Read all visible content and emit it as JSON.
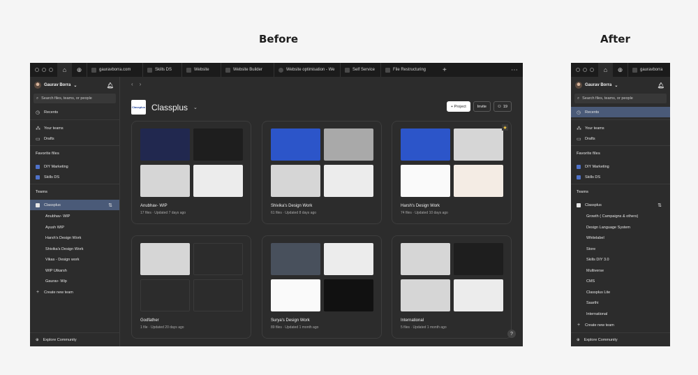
{
  "labels": {
    "before": "Before",
    "after": "After"
  },
  "before": {
    "tabs": [
      {
        "label": "gauravborra.com"
      },
      {
        "label": "Skills DS"
      },
      {
        "label": "Website"
      },
      {
        "label": "Website Builder"
      },
      {
        "label": "Website optimisation - We"
      },
      {
        "label": "Self Service"
      },
      {
        "label": "File Restructuring"
      }
    ],
    "user_name": "Gaurav Borra",
    "search_placeholder": "Search files, teams, or people",
    "nav": {
      "recents": "Recents",
      "your_teams": "Your teams",
      "drafts": "Drafts"
    },
    "favorite_files_label": "Favorite files",
    "favorites": [
      {
        "label": "DIY Marketing"
      },
      {
        "label": "Skills DS"
      }
    ],
    "teams_label": "Teams",
    "team": "Classplus",
    "projects": [
      "Anubhav- WIP",
      "Ayush WIP",
      "Harsh's Design Work",
      "Shivika's Design Work",
      "Vikas - Design work",
      "WIP Utkarsh",
      "Gaurav- Wip"
    ],
    "create_team": "Create new team",
    "explore": "Explore Community",
    "header": {
      "title": "Classplus",
      "logo_text": "Classplus",
      "project_button": "+ Project",
      "invite_button": "Invite",
      "members_count": "19"
    },
    "cards": [
      {
        "name": "Anubhav- WIP",
        "meta": "17 files · Updated 7 days ago"
      },
      {
        "name": "Shivika's Design Work",
        "meta": "61 files · Updated 8 days ago"
      },
      {
        "name": "Harsh's Design Work",
        "meta": "74 files · Updated 10 days ago"
      },
      {
        "name": "Godfather",
        "meta": "1 file · Updated 20 days ago"
      },
      {
        "name": "Surya's Design Work",
        "meta": "89 files · Updated 1 month ago"
      },
      {
        "name": "International",
        "meta": "5 files · Updated 1 month ago"
      }
    ],
    "help": "?"
  },
  "after": {
    "tab": "gauravborra",
    "user_name": "Gaurav Borra",
    "search_placeholder": "Search files, teams, or people",
    "nav": {
      "recents": "Recents",
      "your_teams": "Your teams",
      "drafts": "Drafts"
    },
    "favorite_files_label": "Favorite files",
    "favorites": [
      {
        "label": "DIY Marketing"
      },
      {
        "label": "Skills DS"
      }
    ],
    "teams_label": "Teams",
    "team": "Classplus",
    "projects": [
      "Growth ( Campaigns & others)",
      "Design Language System",
      "Whitelabel",
      "Store",
      "Skills DIY 3.0",
      "Multiverse",
      "CMS",
      "Classplus Lite",
      "Saarthi",
      "International"
    ],
    "create_team": "Create new team",
    "explore": "Explore Community"
  }
}
